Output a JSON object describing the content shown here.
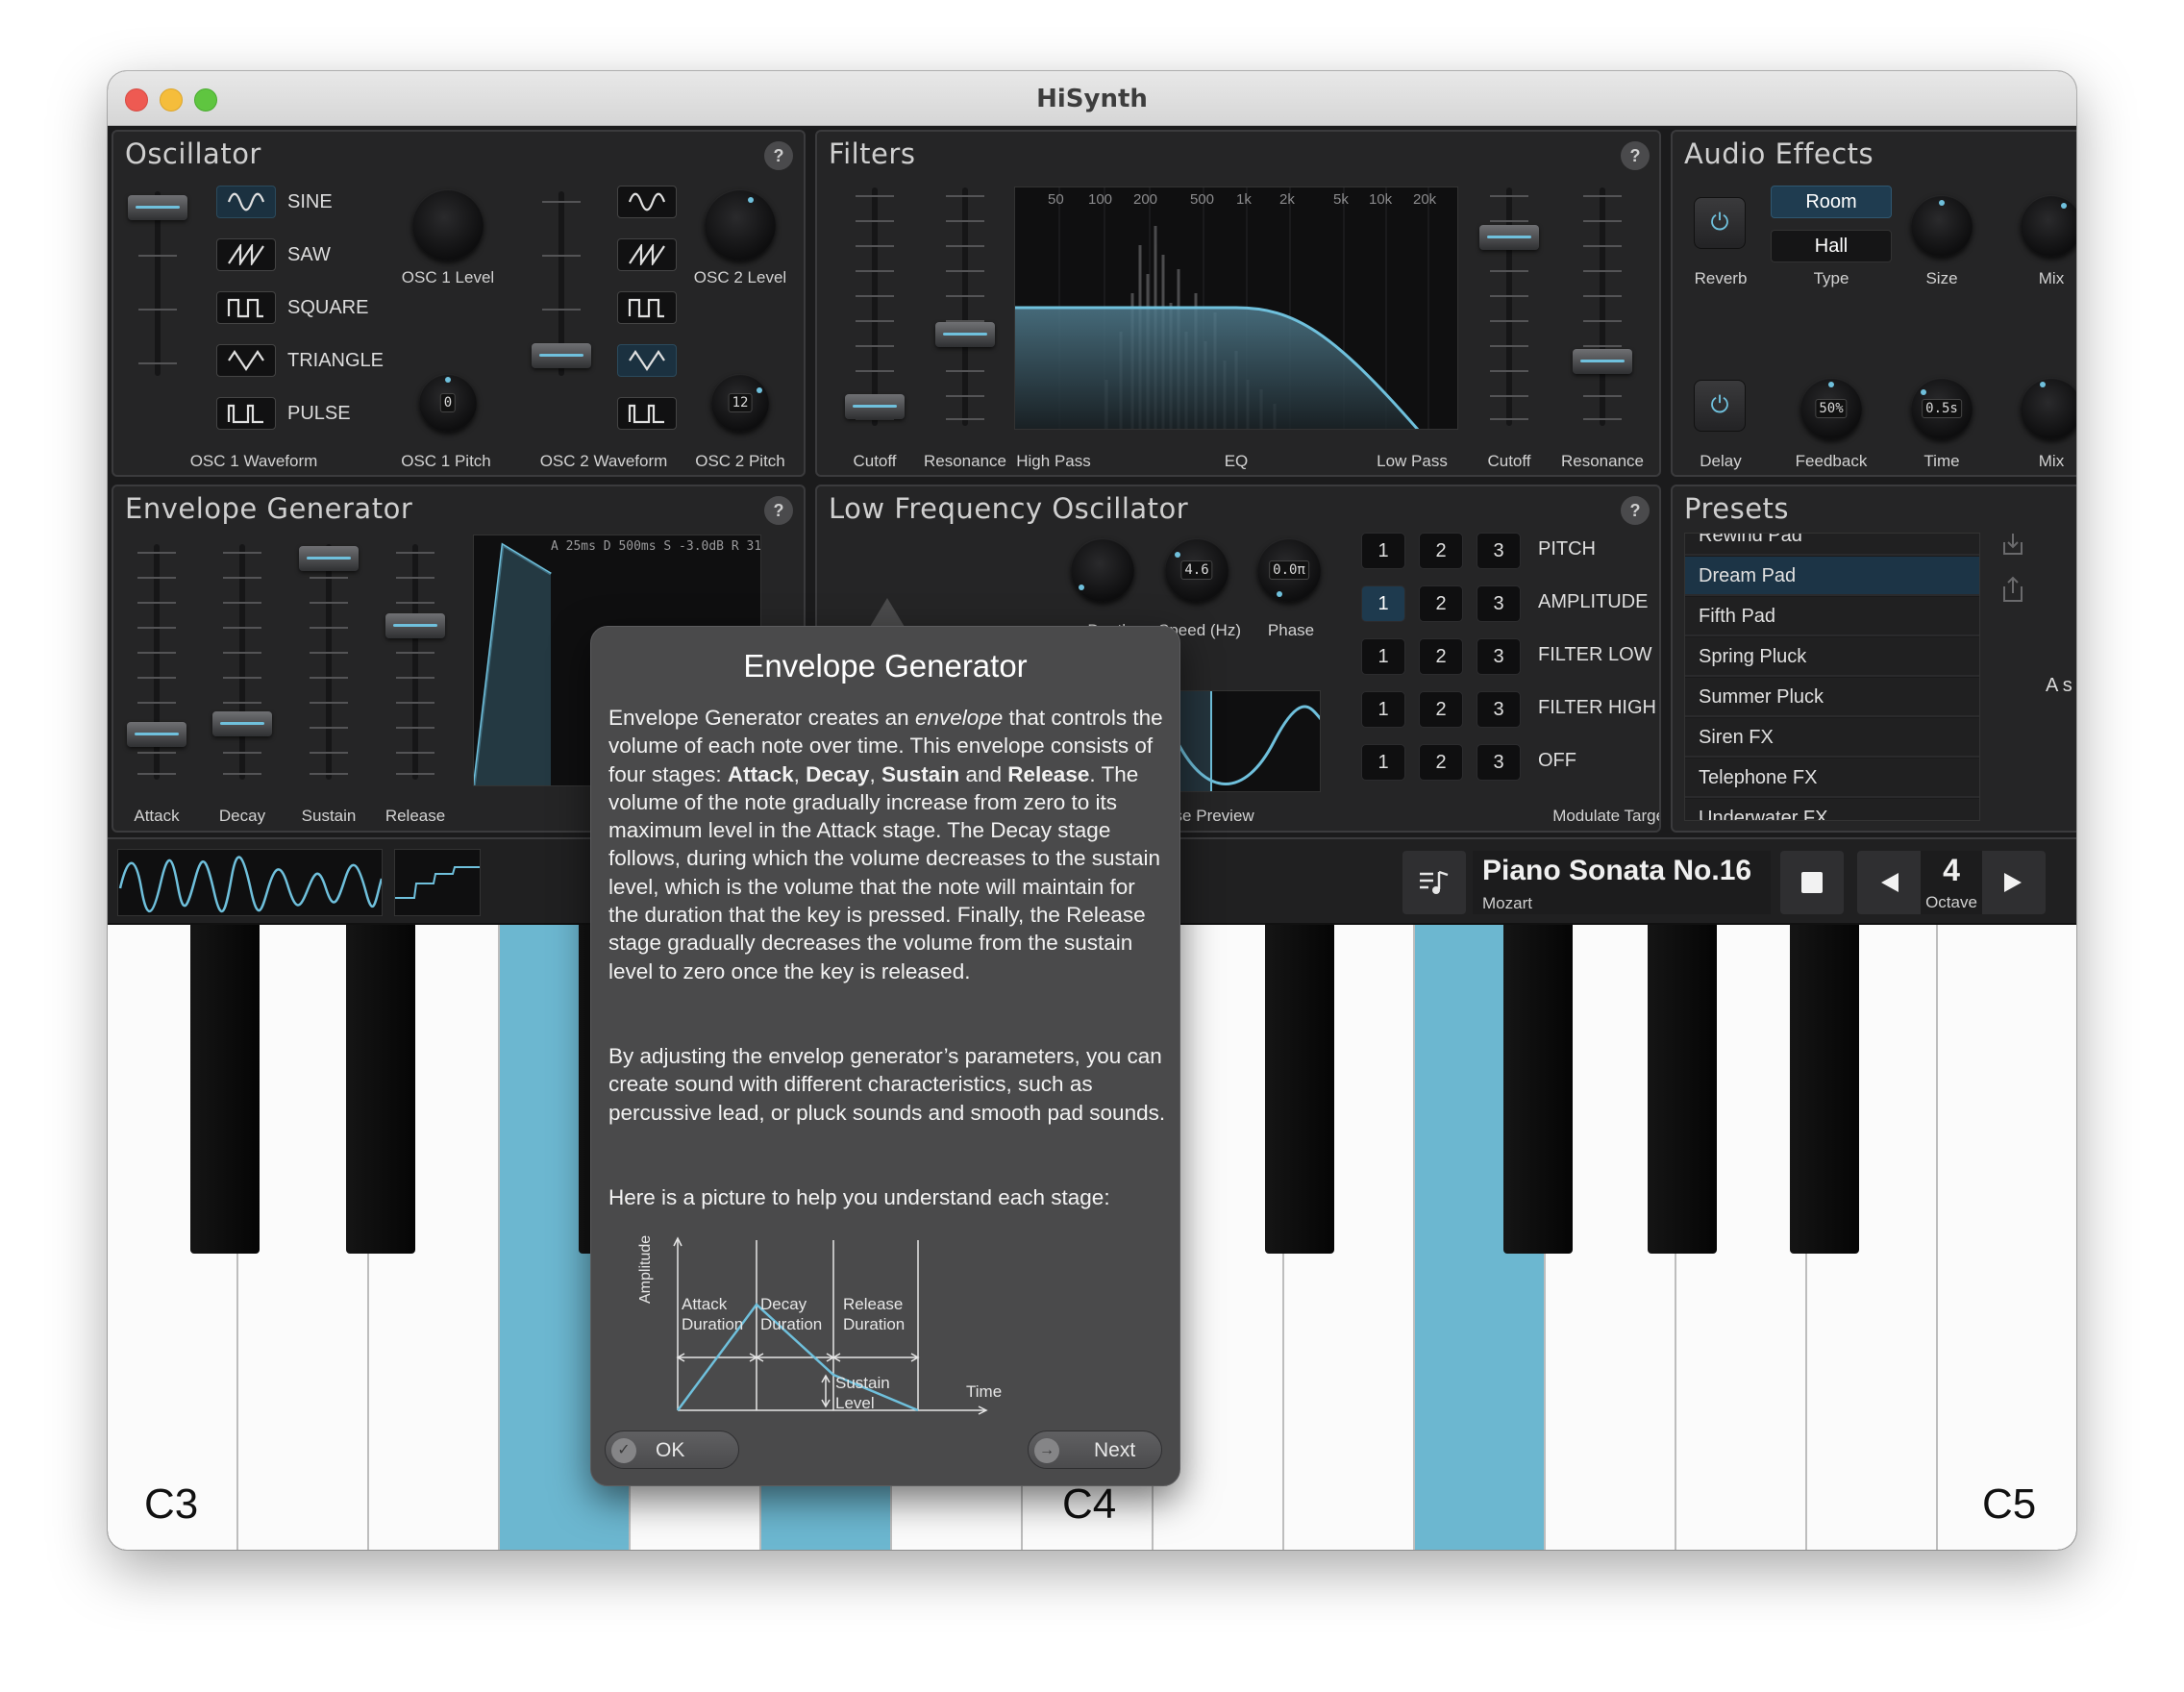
{
  "window": {
    "title": "HiSynth"
  },
  "oscillator": {
    "title": "Oscillator",
    "help": "?",
    "waveforms": [
      "SINE",
      "SAW",
      "SQUARE",
      "TRIANGLE",
      "PULSE"
    ],
    "osc1_selected": "SINE",
    "osc2_selected": "TRIANGLE",
    "osc1_level_label": "OSC 1 Level",
    "osc2_level_label": "OSC 2 Level",
    "osc1_pitch_value": "0",
    "osc2_pitch_value": "12",
    "osc1_waveform_label": "OSC 1 Waveform",
    "osc1_pitch_label": "OSC 1 Pitch",
    "osc2_waveform_label": "OSC 2 Waveform",
    "osc2_pitch_label": "OSC 2 Pitch"
  },
  "filters": {
    "title": "Filters",
    "help": "?",
    "cutoff_label": "Cutoff",
    "resonance_label": "Resonance",
    "highpass_label": "High Pass",
    "eq_label": "EQ",
    "lowpass_label": "Low Pass",
    "cutoff2_label": "Cutoff",
    "resonance2_label": "Resonance",
    "freq_ticks": [
      "50",
      "100",
      "200",
      "500",
      "1k",
      "2k",
      "5k",
      "10k",
      "20k"
    ]
  },
  "audio_effects": {
    "title": "Audio Effects",
    "reverb_label": "Reverb",
    "type_room": "Room",
    "type_hall": "Hall",
    "type_label": "Type",
    "size_label": "Size",
    "mix_label": "Mix",
    "delay_label": "Delay",
    "feedback_value": "50%",
    "feedback_label": "Feedback",
    "time_value": "0.5s",
    "time_label": "Time",
    "mix2_label": "Mix"
  },
  "envelope": {
    "title": "Envelope Generator",
    "help": "?",
    "attack_label": "Attack",
    "decay_label": "Decay",
    "sustain_label": "Sustain",
    "release_label": "Release",
    "readout": "A 25ms D 500ms S -3.0dB R 31"
  },
  "lfo": {
    "title": "Low Frequency Oscillator",
    "help": "?",
    "depth_label": "Depth",
    "speed_value": "4.6",
    "speed_label": "Speed (Hz)",
    "phase_value": "0.0π",
    "phase_label": "Phase",
    "phase_preview_label": "Phase Preview",
    "modulate_target_label": "Modulate Target",
    "targets": [
      "PITCH",
      "AMPLITUDE",
      "FILTER LOW",
      "FILTER HIGH",
      "OFF"
    ],
    "numbers": [
      "1",
      "2",
      "3"
    ]
  },
  "presets": {
    "title": "Presets",
    "items": [
      "Rewind Pad",
      "Dream Pad",
      "Fifth Pad",
      "Spring Pluck",
      "Summer Pluck",
      "Siren FX",
      "Telephone FX",
      "Underwater FX"
    ],
    "selected": "Dream Pad",
    "side_text": "A s"
  },
  "transport": {
    "song_title": "Piano Sonata No.16",
    "composer": "Mozart",
    "octave_value": "4",
    "octave_label": "Octave"
  },
  "keyboard": {
    "labels": [
      "C3",
      "C4",
      "C5"
    ],
    "highlight_color": "#6cb7d0"
  },
  "popover": {
    "title": "Envelope Generator",
    "p1_a": "Envelope Generator creates an ",
    "p1_em": "envelope",
    "p1_b": " that controls the volume of each note over time. This envelope consists of four stages: ",
    "p1_attack": "Attack",
    "p1_comma1": ", ",
    "p1_decay": "Decay",
    "p1_comma2": ", ",
    "p1_sustain": "Sustain",
    "p1_and": " and ",
    "p1_release": "Release",
    "p1_c": ". The volume of the note gradually increase from zero to its maximum level in the Attack stage. The Decay stage follows, during which the volume decreases to the sustain level, which is the volume that the note will maintain for the duration that the key is pressed. Finally, the Release stage gradually decreases the volume from the sustain level to zero once the key is released.",
    "p2": "By adjusting the envelop generator’s parameters, you can create sound with different characteristics, such as percussive lead, or pluck sounds and smooth pad sounds.",
    "p3": "Here is a picture to help you understand each stage:",
    "diagram": {
      "amplitude": "Amplitude",
      "attack1": "Attack",
      "attack2": "Duration",
      "decay1": "Decay",
      "decay2": "Duration",
      "release1": "Release",
      "release2": "Duration",
      "sustain1": "Sustain",
      "sustain2": "Level",
      "time": "Time"
    },
    "ok_label": "OK",
    "next_label": "Next"
  },
  "colors": {
    "accent": "#6fc0dc",
    "panel": "#252526",
    "key_highlight": "#6cb7d0"
  }
}
